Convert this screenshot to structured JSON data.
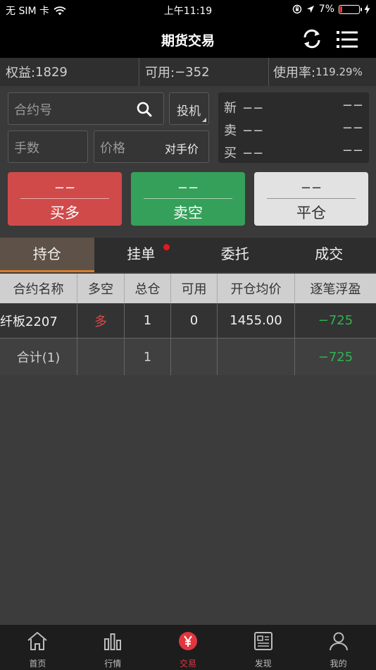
{
  "status": {
    "carrier": "无 SIM 卡",
    "time": "上午11:19",
    "battery": "7%"
  },
  "nav": {
    "title": "期货交易",
    "refresh_icon": "refresh-icon",
    "menu_icon": "list-menu-icon"
  },
  "summary": {
    "equity_label": "权益:",
    "equity_value": "1829",
    "available_label": "可用:",
    "available_value": "−352",
    "usage_label": "使用率:",
    "usage_value": "119.29%"
  },
  "order": {
    "contract_placeholder": "合约号",
    "speculation_label": "投机",
    "qty_placeholder": "手数",
    "price_placeholder": "价格",
    "price_mode": "对手价"
  },
  "quote": {
    "rows": [
      {
        "label": "新",
        "left": "−−",
        "right": "−−"
      },
      {
        "label": "卖",
        "left": "−−",
        "right": "−−"
      },
      {
        "label": "买",
        "left": "−−",
        "right": "−−"
      }
    ]
  },
  "buttons": {
    "buy": {
      "value": "−−",
      "label": "买多",
      "color": "#d04a4a"
    },
    "sell": {
      "value": "−−",
      "label": "卖空",
      "color": "#35a05a"
    },
    "close": {
      "value": "−−",
      "label": "平仓",
      "color": "#e2e2e2"
    }
  },
  "tabs": [
    {
      "label": "持仓",
      "active": true
    },
    {
      "label": "挂单",
      "active": false
    },
    {
      "label": "委托",
      "active": false
    },
    {
      "label": "成交",
      "active": false
    }
  ],
  "table": {
    "headers": [
      "合约名称",
      "多空",
      "总仓",
      "可用",
      "开仓均价",
      "逐笔浮盈"
    ],
    "rows": [
      [
        "纤板2207",
        "多",
        "1",
        "0",
        "1455.00",
        "−725"
      ]
    ],
    "total": [
      "合计(1)",
      "",
      "1",
      "",
      "",
      "−725"
    ]
  },
  "bottom_nav": [
    {
      "label": "首页",
      "icon": "home-icon"
    },
    {
      "label": "行情",
      "icon": "bar-chart-icon"
    },
    {
      "label": "交易",
      "icon": "yen-icon",
      "active": true
    },
    {
      "label": "发现",
      "icon": "news-icon"
    },
    {
      "label": "我的",
      "icon": "person-icon"
    }
  ],
  "colors": {
    "accent": "#d87e2c",
    "up": "#e04848",
    "down": "#2fb24f",
    "active_nav": "#e3353e"
  }
}
